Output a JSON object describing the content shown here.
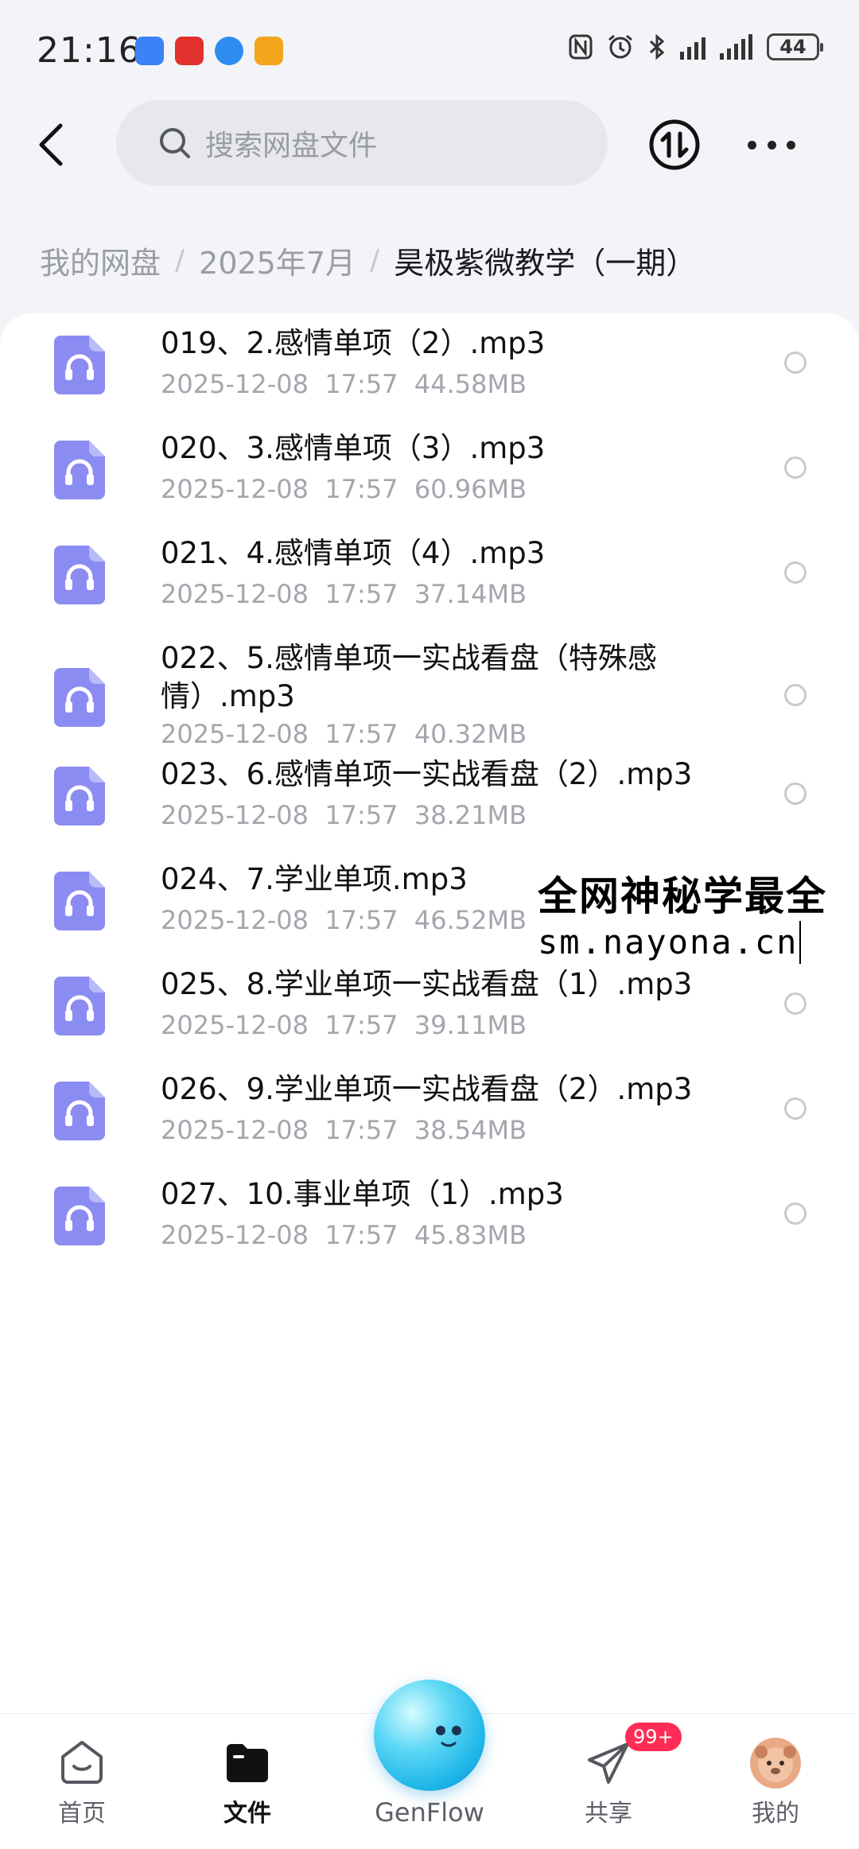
{
  "status_bar": {
    "time": "21:16",
    "battery": "44",
    "app_icons": [
      {
        "name": "app-icon-blue",
        "color": "#3b82f6"
      },
      {
        "name": "app-icon-red",
        "color": "#e0312d"
      },
      {
        "name": "app-icon-blue-logo",
        "color": "#2f8df2"
      },
      {
        "name": "app-icon-orange",
        "color": "#f4a51c"
      }
    ]
  },
  "search": {
    "placeholder": "搜索网盘文件"
  },
  "breadcrumb": {
    "root": "我的网盘",
    "folder": "2025年7月",
    "current": "昊极紫微教学（一期）"
  },
  "files": [
    {
      "name": "019、2.感情单项（2）.mp3",
      "date": "2025-12-08",
      "time": "17:57",
      "size": "44.58MB"
    },
    {
      "name": "020、3.感情单项（3）.mp3",
      "date": "2025-12-08",
      "time": "17:57",
      "size": "60.96MB"
    },
    {
      "name": "021、4.感情单项（4）.mp3",
      "date": "2025-12-08",
      "time": "17:57",
      "size": "37.14MB"
    },
    {
      "name": "022、5.感情单项一实战看盘（特殊感情）.mp3",
      "date": "2025-12-08",
      "time": "17:57",
      "size": "40.32MB"
    },
    {
      "name": "023、6.感情单项一实战看盘（2）.mp3",
      "date": "2025-12-08",
      "time": "17:57",
      "size": "38.21MB"
    },
    {
      "name": "024、7.学业单项.mp3",
      "date": "2025-12-08",
      "time": "17:57",
      "size": "46.52MB"
    },
    {
      "name": "025、8.学业单项一实战看盘（1）.mp3",
      "date": "2025-12-08",
      "time": "17:57",
      "size": "39.11MB"
    },
    {
      "name": "026、9.学业单项一实战看盘（2）.mp3",
      "date": "2025-12-08",
      "time": "17:57",
      "size": "38.54MB"
    },
    {
      "name": "027、10.事业单项（1）.mp3",
      "date": "2025-12-08",
      "time": "17:57",
      "size": "45.83MB"
    }
  ],
  "watermark": {
    "line1": "全网神秘学最全",
    "line2": "sm.nayona.cn"
  },
  "bottom_nav": {
    "home": "首页",
    "files": "文件",
    "genflow": "GenFlow",
    "share": "共享",
    "share_badge": "99+",
    "me": "我的"
  },
  "colors": {
    "file_icon": "#8b8cf2",
    "accent_badge": "#ff2d55",
    "orb": "#1eb6e9"
  }
}
